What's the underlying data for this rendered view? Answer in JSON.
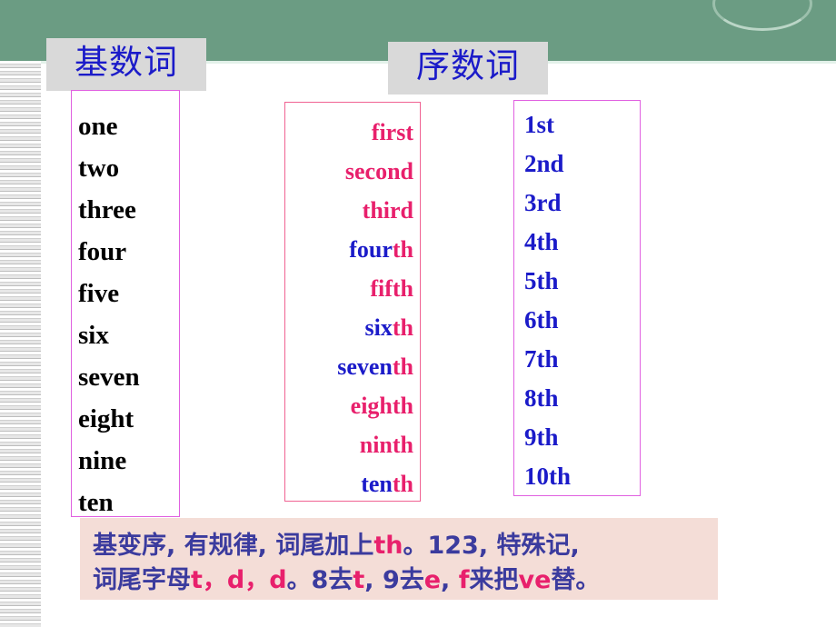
{
  "slide": {
    "header": {
      "band_color": "#6b9c83",
      "arc_color": "#d4e8dc",
      "underline_color": "#e3f1ea"
    },
    "side_strip": {
      "name": "striped-left-margin",
      "colors": [
        "#ffffff",
        "#cfcfcf",
        "#e7e7e7",
        "#bdbdbd"
      ]
    }
  },
  "titles": {
    "cardinal": "基数词",
    "ordinal": "序数词",
    "title_color": "#1b1bc9",
    "title_bg": "#d9d9d9"
  },
  "cardinal_numbers": [
    "one",
    "two",
    "three",
    "four",
    "five",
    "six",
    "seven",
    "eight",
    "nine",
    "ten"
  ],
  "ordinal_words": [
    {
      "stem": "first",
      "stem_color": "pink",
      "suffix": "",
      "suffix_color": "pink"
    },
    {
      "stem": "second",
      "stem_color": "pink",
      "suffix": "",
      "suffix_color": "pink"
    },
    {
      "stem": "third",
      "stem_color": "pink",
      "suffix": "",
      "suffix_color": "pink"
    },
    {
      "stem": "four",
      "stem_color": "blue",
      "suffix": "th",
      "suffix_color": "pink"
    },
    {
      "stem": "fifth",
      "stem_color": "pink",
      "suffix": "",
      "suffix_color": "pink"
    },
    {
      "stem": "six",
      "stem_color": "blue",
      "suffix": "th",
      "suffix_color": "pink"
    },
    {
      "stem": "seven",
      "stem_color": "blue",
      "suffix": "th",
      "suffix_color": "pink"
    },
    {
      "stem": "eighth",
      "stem_color": "pink",
      "suffix": "",
      "suffix_color": "pink"
    },
    {
      "stem": "ninth",
      "stem_color": "pink",
      "suffix": "",
      "suffix_color": "pink"
    },
    {
      "stem": "ten",
      "stem_color": "blue",
      "suffix": "th",
      "suffix_color": "pink"
    }
  ],
  "ordinal_numerals": [
    "1st",
    "2nd",
    "3rd",
    "4th",
    "5th",
    "6th",
    "7th",
    "8th",
    "9th",
    "10th"
  ],
  "note": {
    "background": "#f4ddd7",
    "base_color": "#3b3b9e",
    "highlight_color": "#e8206c",
    "line1": [
      {
        "t": "基变序, 有规律, 词尾加上",
        "hl": false
      },
      {
        "t": "th",
        "hl": true
      },
      {
        "t": "。123, 特殊记,",
        "hl": false
      }
    ],
    "line2": [
      {
        "t": "词尾字母",
        "hl": false
      },
      {
        "t": "t，d，d",
        "hl": true
      },
      {
        "t": "。8去",
        "hl": false
      },
      {
        "t": "t",
        "hl": true
      },
      {
        "t": ", 9去",
        "hl": false
      },
      {
        "t": "e",
        "hl": true
      },
      {
        "t": ", ",
        "hl": false
      },
      {
        "t": "f",
        "hl": true
      },
      {
        "t": "来把",
        "hl": false
      },
      {
        "t": "ve",
        "hl": true
      },
      {
        "t": "替。",
        "hl": false
      }
    ]
  },
  "colors": {
    "pink": "#e8206c",
    "blue": "#1b1bc9",
    "black": "#000000",
    "box_border": "#e060e0",
    "box_border_pink": "#f06292"
  }
}
